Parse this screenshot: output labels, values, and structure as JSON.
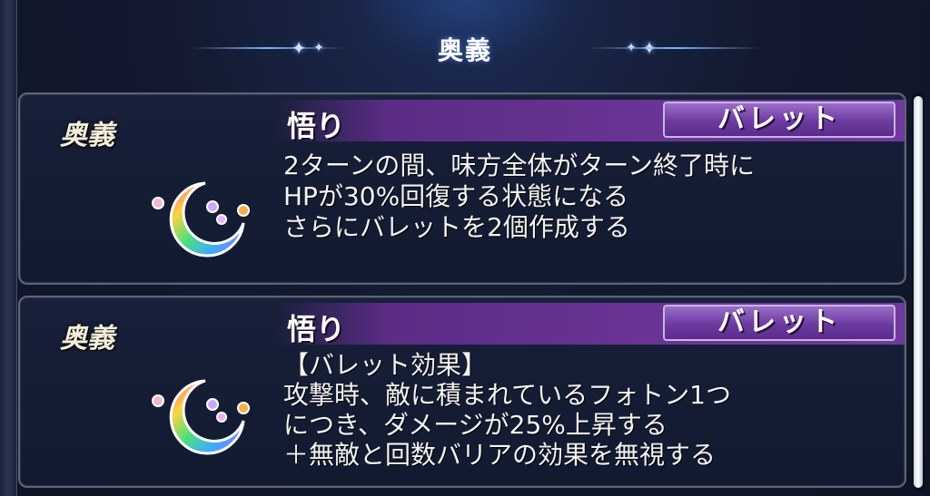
{
  "header": {
    "title": "奥義"
  },
  "cards": [
    {
      "label": "奥義",
      "skill_name": "悟り",
      "type_badge": "バレット",
      "icon": "crescent-moon-icon",
      "description": [
        "2ターンの間、味方全体がターン終了時に",
        "HPが30%回復する状態になる",
        "さらにバレットを2個作成する"
      ]
    },
    {
      "label": "奥義",
      "skill_name": "悟り",
      "type_badge": "バレット",
      "icon": "crescent-moon-icon",
      "description": [
        "【バレット効果】",
        "攻撃時、敵に積まれているフォトン1つ",
        "につき、ダメージが25%上昇する",
        "＋無敵と回数バリアの効果を無視する"
      ]
    }
  ],
  "colors": {
    "title_bar": "#6a3496",
    "badge": "#6c3aa0",
    "card_border": "#5d6477",
    "background": "#131a30"
  }
}
